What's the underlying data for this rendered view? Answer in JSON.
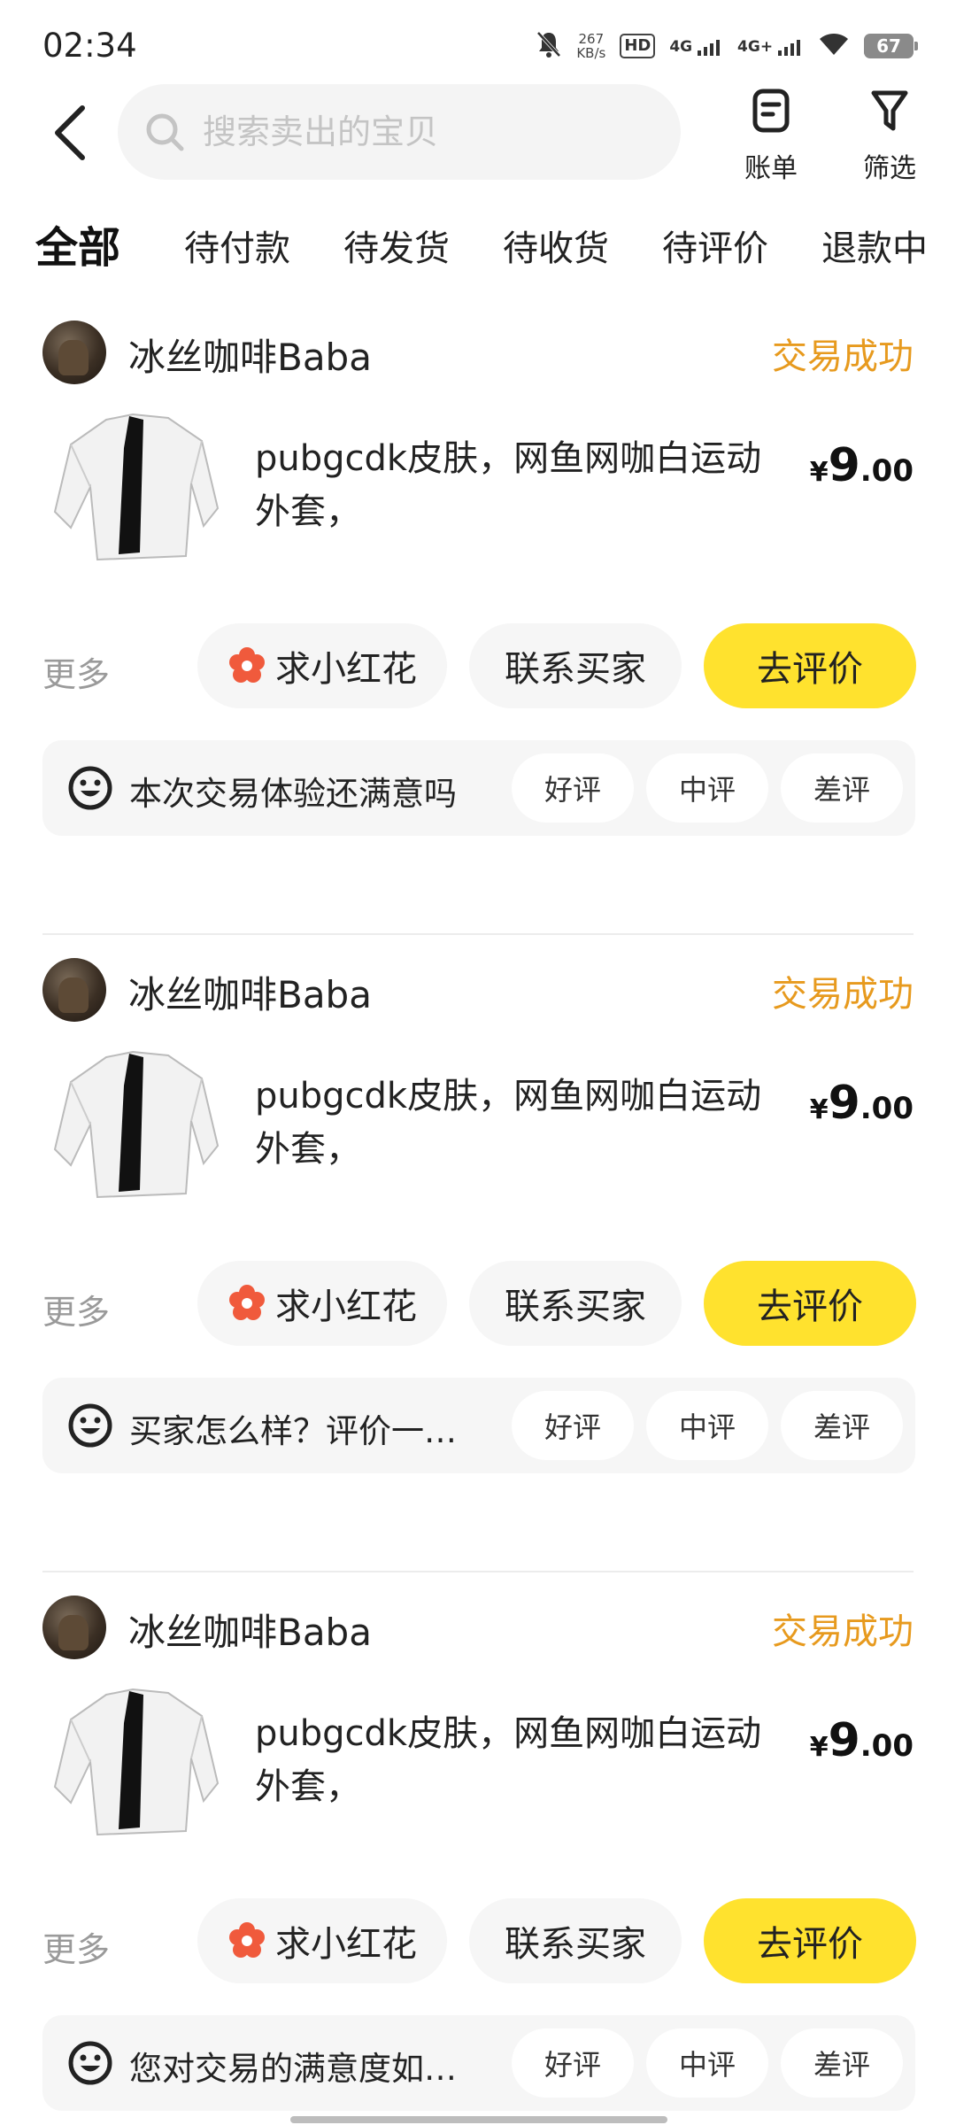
{
  "status_bar": {
    "time": "02:34",
    "net_speed_value": "267",
    "net_speed_unit": "KB/s",
    "hd_label": "HD",
    "sim1_label": "4G",
    "sim2_label": "4G+",
    "battery": "67",
    "icons": [
      "mute-bell-icon",
      "wifi-icon"
    ]
  },
  "header": {
    "search_placeholder": "搜索卖出的宝贝",
    "bill_label": "账单",
    "filter_label": "筛选"
  },
  "tabs": [
    "全部",
    "待付款",
    "待发货",
    "待收货",
    "待评价",
    "退款中"
  ],
  "active_tab": 0,
  "orders": [
    {
      "seller": "冰丝咖啡Baba",
      "status": "交易成功",
      "title": "pubgcdk皮肤，网鱼网咖白运动外套，",
      "price_symbol": "¥",
      "price_int": "9",
      "price_dec": ".00",
      "more_label": "更多",
      "flower_label": "求小红花",
      "contact_label": "联系买家",
      "review_label": "去评价",
      "feedback_prompt": "本次交易体验还满意吗",
      "good_label": "好评",
      "mid_label": "中评",
      "bad_label": "差评"
    },
    {
      "seller": "冰丝咖啡Baba",
      "status": "交易成功",
      "title": "pubgcdk皮肤，网鱼网咖白运动外套，",
      "price_symbol": "¥",
      "price_int": "9",
      "price_dec": ".00",
      "more_label": "更多",
      "flower_label": "求小红花",
      "contact_label": "联系买家",
      "review_label": "去评价",
      "feedback_prompt": "买家怎么样？评价一…",
      "good_label": "好评",
      "mid_label": "中评",
      "bad_label": "差评"
    },
    {
      "seller": "冰丝咖啡Baba",
      "status": "交易成功",
      "title": "pubgcdk皮肤，网鱼网咖白运动外套，",
      "price_symbol": "¥",
      "price_int": "9",
      "price_dec": ".00",
      "more_label": "更多",
      "flower_label": "求小红花",
      "contact_label": "联系买家",
      "review_label": "去评价",
      "feedback_prompt": "您对交易的满意度如…",
      "good_label": "好评",
      "mid_label": "中评",
      "bad_label": "差评"
    }
  ],
  "colors": {
    "accent_yellow": "#ffe22e",
    "status_orange": "#e79a1e",
    "flower_red": "#f05a3c"
  }
}
